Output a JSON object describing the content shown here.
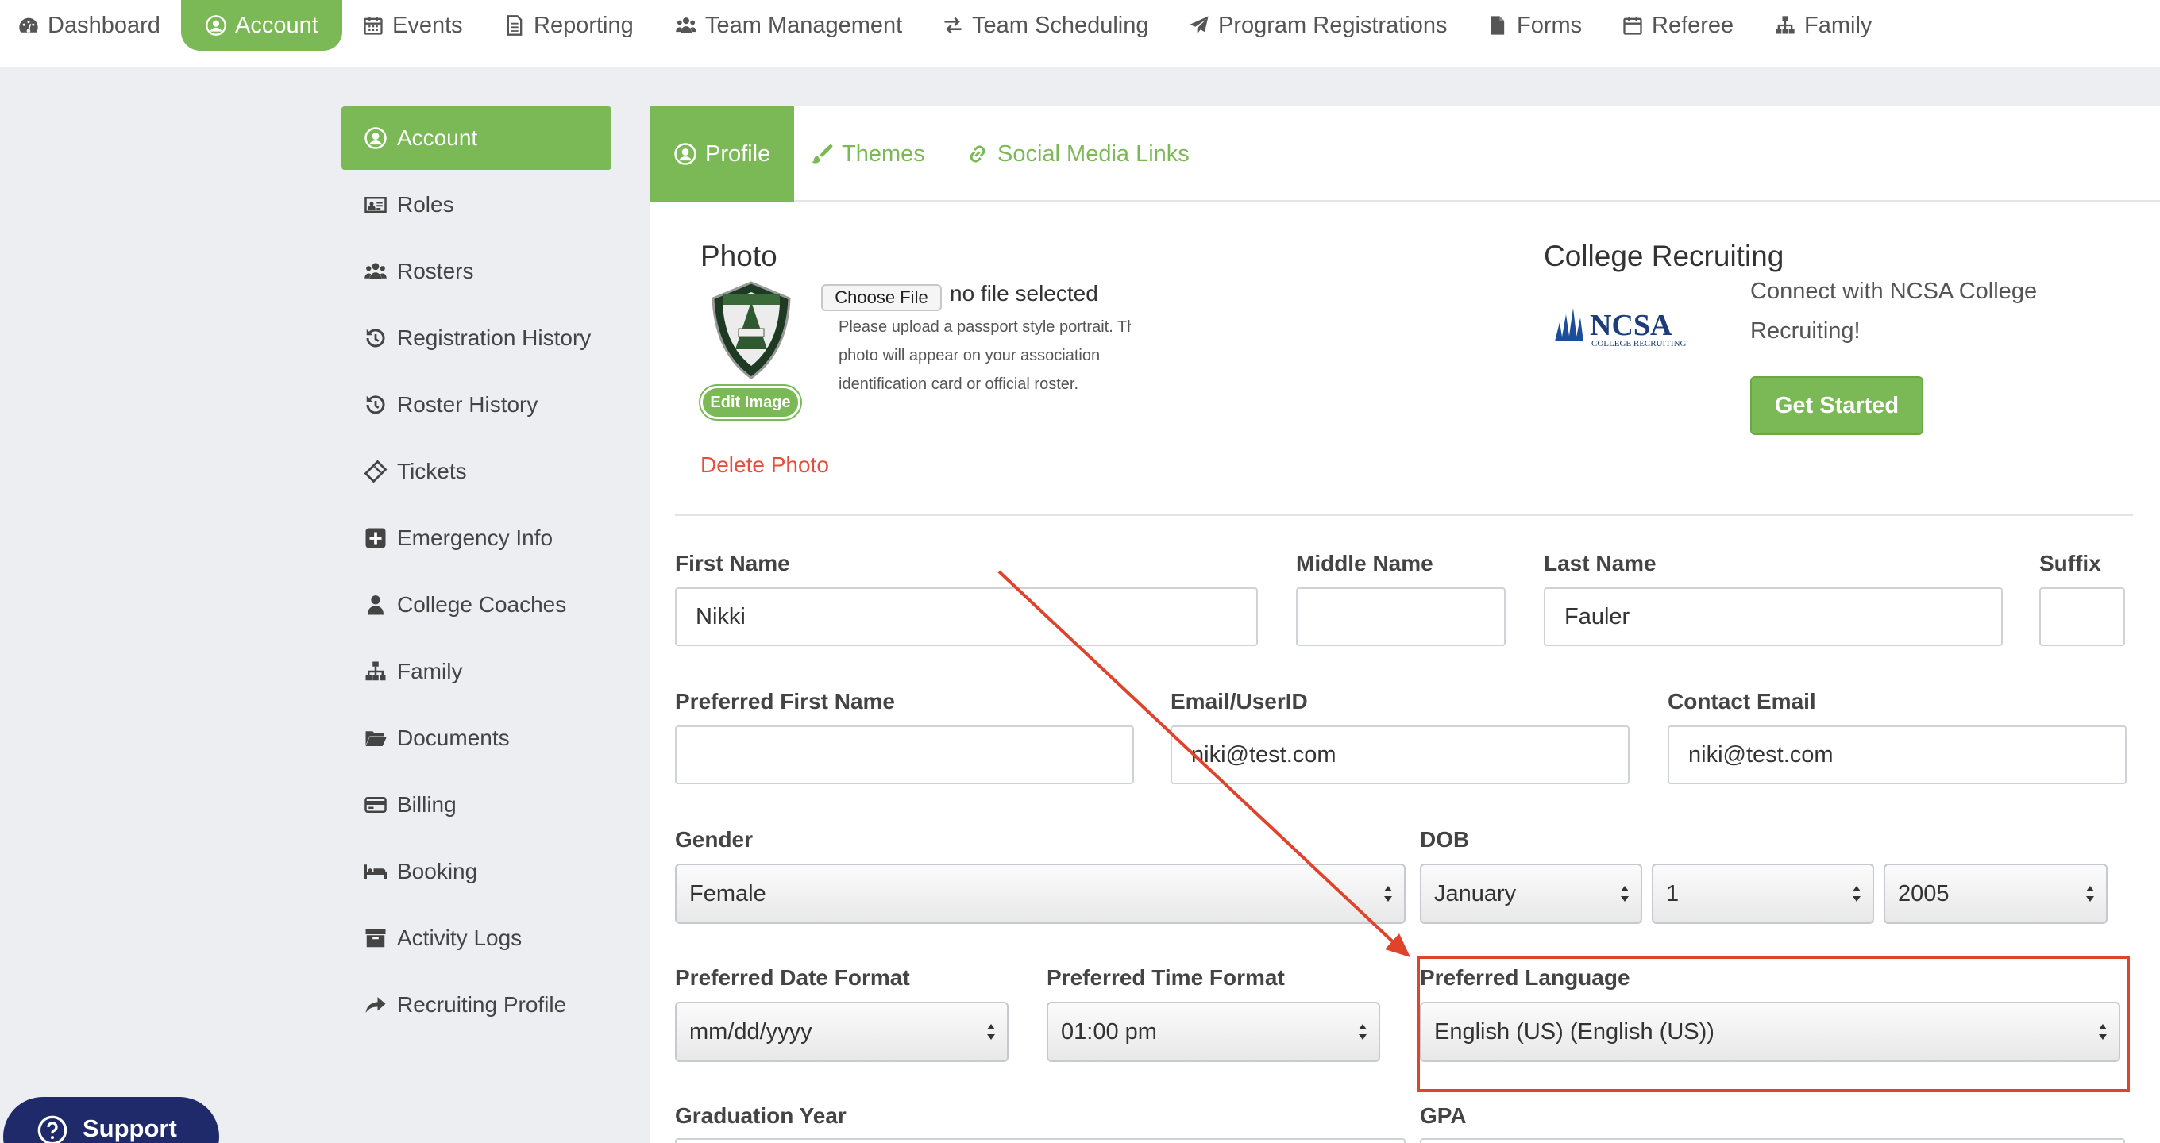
{
  "topnav": {
    "items": [
      {
        "label": "Dashboard",
        "icon": "dashboard-icon"
      },
      {
        "label": "Account",
        "icon": "user-circle-icon",
        "active": true
      },
      {
        "label": "Events",
        "icon": "calendar-icon"
      },
      {
        "label": "Reporting",
        "icon": "document-icon"
      },
      {
        "label": "Team Management",
        "icon": "users-icon"
      },
      {
        "label": "Team Scheduling",
        "icon": "exchange-icon"
      },
      {
        "label": "Program Registrations",
        "icon": "paper-plane-icon"
      },
      {
        "label": "Forms",
        "icon": "file-icon"
      },
      {
        "label": "Referee",
        "icon": "calendar-icon"
      },
      {
        "label": "Family",
        "icon": "sitemap-icon"
      }
    ]
  },
  "sidebar": {
    "items": [
      {
        "label": "Account",
        "icon": "user-circle-icon",
        "active": true
      },
      {
        "label": "Roles",
        "icon": "id-card-icon"
      },
      {
        "label": "Rosters",
        "icon": "users-icon"
      },
      {
        "label": "Registration History",
        "icon": "history-icon"
      },
      {
        "label": "Roster History",
        "icon": "history-icon"
      },
      {
        "label": "Tickets",
        "icon": "ticket-icon"
      },
      {
        "label": "Emergency Info",
        "icon": "plus-square-icon"
      },
      {
        "label": "College Coaches",
        "icon": "user-icon"
      },
      {
        "label": "Family",
        "icon": "sitemap-icon"
      },
      {
        "label": "Documents",
        "icon": "folder-open-icon"
      },
      {
        "label": "Billing",
        "icon": "credit-card-icon"
      },
      {
        "label": "Booking",
        "icon": "bed-icon"
      },
      {
        "label": "Activity Logs",
        "icon": "archive-icon"
      },
      {
        "label": "Recruiting Profile",
        "icon": "share-icon"
      }
    ]
  },
  "tabs": [
    {
      "label": "Profile",
      "icon": "user-circle-icon",
      "active": true
    },
    {
      "label": "Themes",
      "icon": "paint-brush-icon"
    },
    {
      "label": "Social Media Links",
      "icon": "link-icon"
    }
  ],
  "photo": {
    "heading": "Photo",
    "choose_file": "Choose File",
    "no_file": "no file selected",
    "note_lines": [
      "Please upload a passport style portrait. Th",
      "photo will appear on your association",
      "identification card or official roster."
    ],
    "edit_image": "Edit Image",
    "delete_photo": "Delete Photo"
  },
  "recruiting": {
    "heading": "College Recruiting",
    "logo_text": "NCSA",
    "logo_sub": "COLLEGE RECRUITING",
    "text_lines": [
      "Connect with NCSA College",
      "Recruiting!"
    ],
    "button": "Get Started"
  },
  "form": {
    "first_name": {
      "label": "First Name",
      "value": "Nikki"
    },
    "middle_name": {
      "label": "Middle Name",
      "value": ""
    },
    "last_name": {
      "label": "Last Name",
      "value": "Fauler"
    },
    "suffix": {
      "label": "Suffix",
      "value": ""
    },
    "preferred_first_name": {
      "label": "Preferred First Name",
      "value": ""
    },
    "email_userid": {
      "label": "Email/UserID",
      "value": "niki@test.com"
    },
    "contact_email": {
      "label": "Contact Email",
      "value": "niki@test.com"
    },
    "gender": {
      "label": "Gender",
      "value": "Female"
    },
    "dob": {
      "label": "DOB",
      "month": "January",
      "day": "1",
      "year": "2005"
    },
    "date_format": {
      "label": "Preferred Date Format",
      "value": "mm/dd/yyyy"
    },
    "time_format": {
      "label": "Preferred Time Format",
      "value": "01:00 pm"
    },
    "language": {
      "label": "Preferred Language",
      "value": "English (US) (English (US))"
    },
    "graduation_year": {
      "label": "Graduation Year"
    },
    "gpa": {
      "label": "GPA"
    }
  },
  "support": {
    "label": "Support"
  },
  "colors": {
    "accent": "#7bb956",
    "annotation": "#e0432b",
    "danger": "#e84c3d",
    "support_bg": "#1f2a6b"
  }
}
